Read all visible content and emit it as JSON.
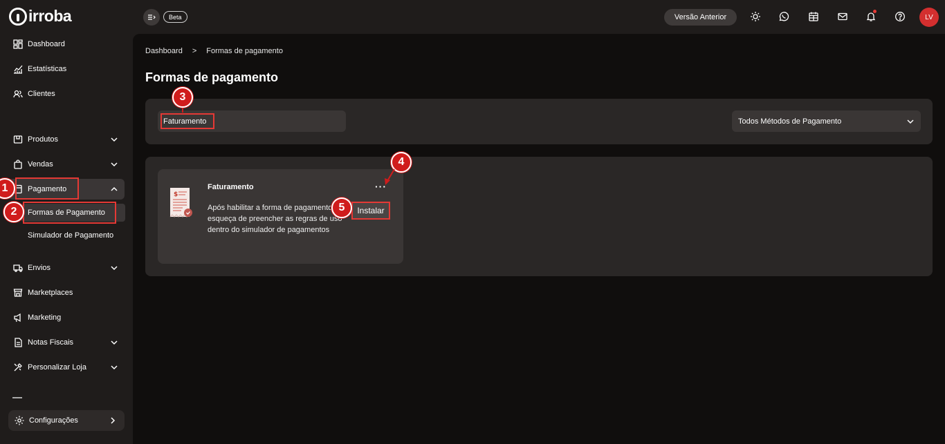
{
  "brand": {
    "name": "irroba"
  },
  "topbar": {
    "beta_label": "Beta",
    "prev_version_label": "Versão Anterior",
    "avatar_initials": "LV",
    "icons": [
      "sun-icon",
      "whatsapp-icon",
      "calendar-icon",
      "mail-icon",
      "bell-icon",
      "help-icon"
    ]
  },
  "sidebar": {
    "items": [
      {
        "label": "Dashboard",
        "icon": "dashboard-icon"
      },
      {
        "label": "Estatísticas",
        "icon": "stats-icon"
      },
      {
        "label": "Clientes",
        "icon": "clients-icon"
      },
      {
        "label": "Produtos",
        "icon": "box-icon"
      },
      {
        "label": "Vendas",
        "icon": "bag-icon"
      },
      {
        "label": "Pagamento",
        "icon": "payment-icon"
      },
      {
        "label": "Envios",
        "icon": "truck-icon"
      },
      {
        "label": "Marketplaces",
        "icon": "store-icon"
      },
      {
        "label": "Marketing",
        "icon": "megaphone-icon"
      },
      {
        "label": "Notas Fiscais",
        "icon": "invoice-icon"
      },
      {
        "label": "Personalizar Loja",
        "icon": "tools-icon"
      }
    ],
    "sub_items": [
      {
        "label": "Formas de Pagamento"
      },
      {
        "label": "Simulador de Pagamento"
      }
    ],
    "config_label": "Configurações"
  },
  "main": {
    "breadcrumb": {
      "home": "Dashboard",
      "separator": ">",
      "current": "Formas de pagamento"
    },
    "title": "Formas de pagamento",
    "search_value": "Faturamento",
    "method_select": "Todos Métodos de Pagamento",
    "card": {
      "title": "Faturamento",
      "dots": "···",
      "description": "Após habilitar a forma de pagamento, não esqueça de preencher as regras de uso dentro do simulador de pagamentos",
      "install_label": "Instalar"
    }
  },
  "annotations": {
    "steps": [
      "1",
      "2",
      "3",
      "4",
      "5"
    ],
    "color": "#e53935"
  }
}
